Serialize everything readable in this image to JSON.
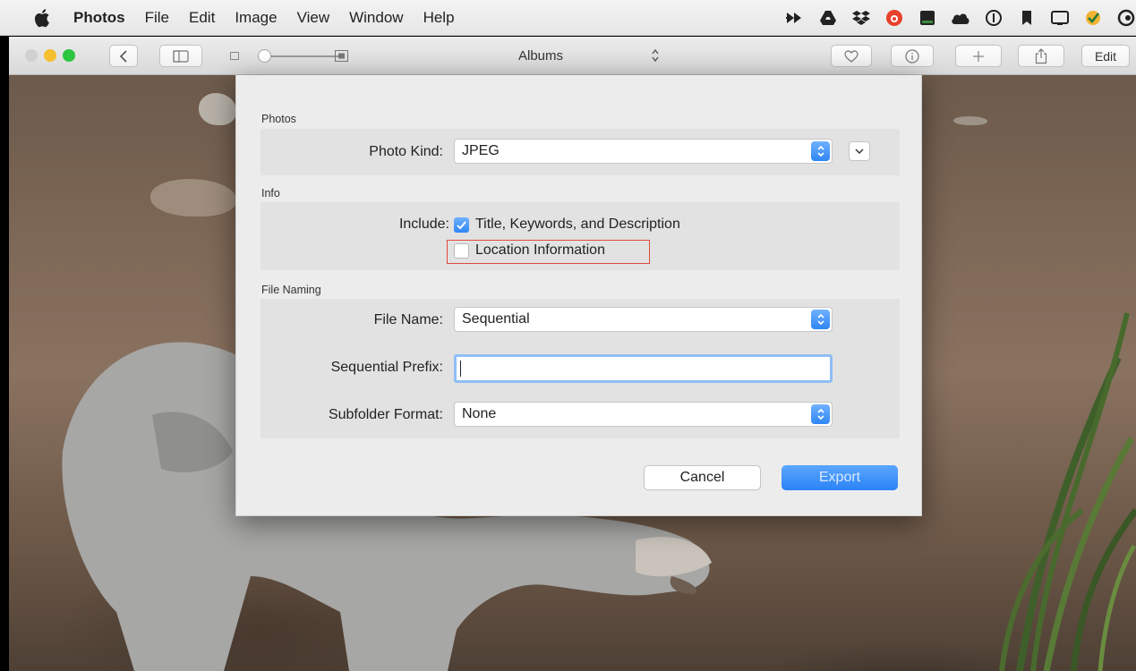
{
  "menubar": {
    "app_name": "Photos",
    "items": [
      "File",
      "Edit",
      "Image",
      "View",
      "Window",
      "Help"
    ]
  },
  "toolbar": {
    "albums_label": "Albums",
    "edit_label": "Edit"
  },
  "dialog": {
    "photos_section": {
      "title": "Photos",
      "photo_kind_label": "Photo Kind:",
      "photo_kind_value": "JPEG"
    },
    "info_section": {
      "title": "Info",
      "include_label": "Include:",
      "title_keywords_label": "Title, Keywords, and Description",
      "title_keywords_checked": true,
      "location_label": "Location Information",
      "location_checked": false
    },
    "file_naming_section": {
      "title": "File Naming",
      "file_name_label": "File Name:",
      "file_name_value": "Sequential",
      "sequential_prefix_label": "Sequential Prefix:",
      "sequential_prefix_value": "",
      "subfolder_format_label": "Subfolder Format:",
      "subfolder_format_value": "None"
    },
    "cancel_label": "Cancel",
    "export_label": "Export"
  },
  "colors": {
    "accent": "#2f86f5",
    "highlight_border": "#e0493b"
  }
}
